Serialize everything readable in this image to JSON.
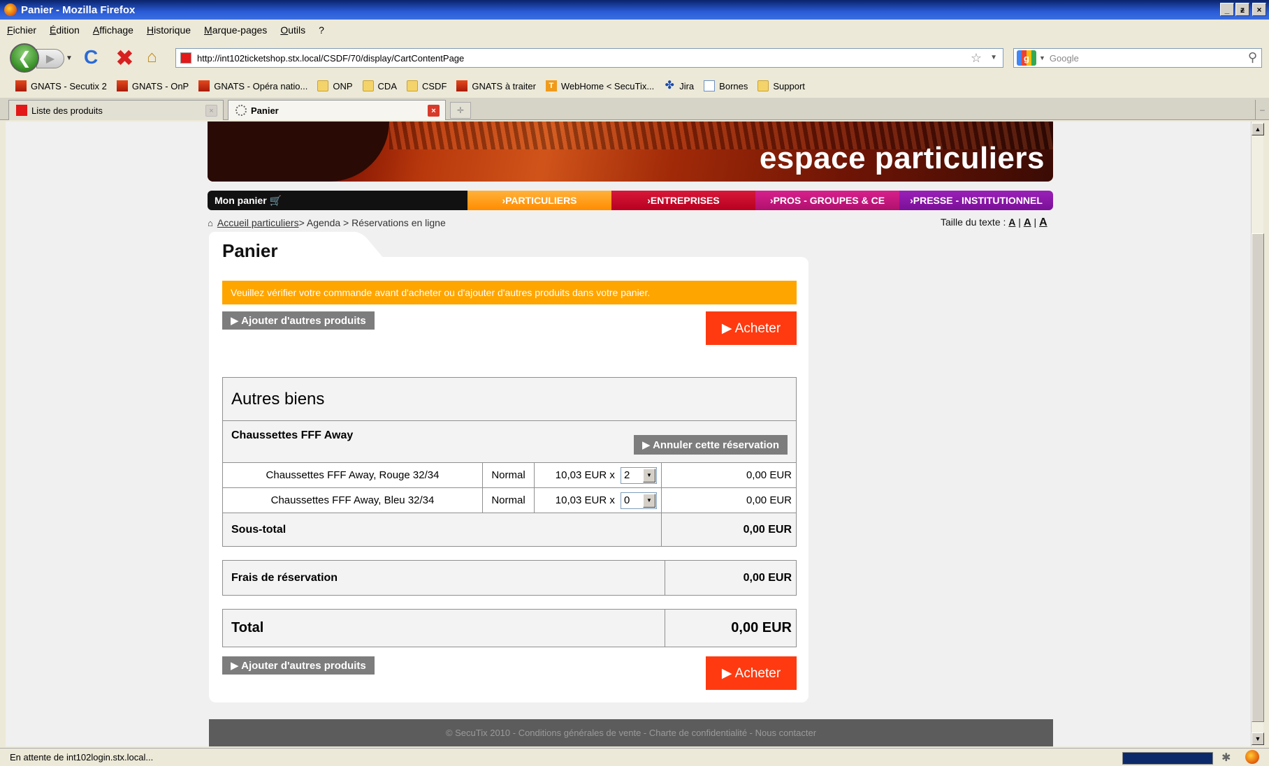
{
  "window": {
    "title": "Panier - Mozilla Firefox",
    "controls": [
      "_",
      "ᵶ",
      "X"
    ]
  },
  "menu": [
    "Fichier",
    "Édition",
    "Affichage",
    "Historique",
    "Marque-pages",
    "Outils",
    "?"
  ],
  "toolbar": {
    "url": "http://int102ticketshop.stx.local/CSDF/70/display/CartContentPage",
    "search_placeholder": "Google"
  },
  "bookmarks": [
    {
      "label": "GNATS - Secutix 2",
      "icon": "red"
    },
    {
      "label": "GNATS - OnP",
      "icon": "red"
    },
    {
      "label": "GNATS - Opéra natio...",
      "icon": "red"
    },
    {
      "label": "ONP",
      "icon": "folder"
    },
    {
      "label": "CDA",
      "icon": "folder"
    },
    {
      "label": "CSDF",
      "icon": "folder"
    },
    {
      "label": "GNATS à traiter",
      "icon": "red"
    },
    {
      "label": "WebHome < SecuTix...",
      "icon": "t"
    },
    {
      "label": "Jira",
      "icon": "jira"
    },
    {
      "label": "Bornes",
      "icon": "page"
    },
    {
      "label": "Support",
      "icon": "folder"
    }
  ],
  "tabs": [
    {
      "label": "Liste des produits",
      "active": false
    },
    {
      "label": "Panier",
      "active": true
    }
  ],
  "site": {
    "banner_title": "espace particuliers",
    "nav": {
      "panier": "Mon panier 🛒",
      "particuliers": "›PARTICULIERS",
      "entreprises": "›ENTREPRISES",
      "pros": "›PROS - GROUPES & CE",
      "presse": "›PRESSE - INSTITUTIONNEL"
    },
    "breadcrumb": {
      "home": "Accueil particuliers",
      "rest": " > Agenda > Réservations en ligne"
    },
    "textsize_label": "Taille du texte : "
  },
  "cart": {
    "title": "Panier",
    "notice": "Veuillez vérifier votre commande avant d'acheter ou d'ajouter d'autres produits dans votre panier.",
    "add_more": "▶ Ajouter d'autres produits",
    "buy": "▶ Acheter",
    "section": "Autres biens",
    "product_name": "Chaussettes FFF Away",
    "cancel": "▶ Annuler cette réservation",
    "items": [
      {
        "name": "Chaussettes FFF Away,  Rouge  32/34",
        "tariff": "Normal",
        "price": "10,03 EUR x",
        "qty": "2",
        "amount": "0,00 EUR"
      },
      {
        "name": "Chaussettes FFF Away,  Bleu  32/34",
        "tariff": "Normal",
        "price": "10,03 EUR x",
        "qty": "0",
        "amount": "0,00 EUR"
      }
    ],
    "subtotal_label": "Sous-total",
    "subtotal": "0,00 EUR",
    "fees_label": "Frais de réservation",
    "fees": "0,00 EUR",
    "total_label": "Total",
    "total": "0,00 EUR"
  },
  "footer": "© SecuTix 2010 - Conditions générales de vente - Charte de confidentialité - Nous contacter",
  "status": "En attente de int102login.stx.local..."
}
